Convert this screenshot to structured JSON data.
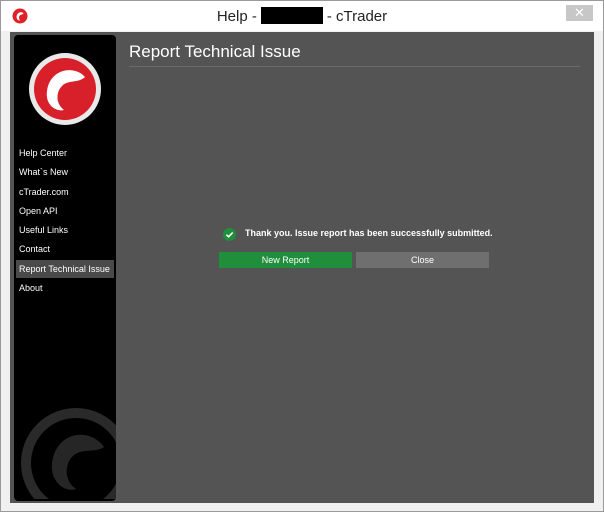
{
  "window": {
    "title_prefix": "Help -",
    "title_suffix": "- cTrader",
    "close_glyph": "✕"
  },
  "sidebar": {
    "items": [
      {
        "label": "Help Center"
      },
      {
        "label": "What`s New"
      },
      {
        "label": "cTrader.com"
      },
      {
        "label": "Open API"
      },
      {
        "label": "Useful Links"
      },
      {
        "label": "Contact"
      },
      {
        "label": "Report Technical Issue",
        "active": true
      },
      {
        "label": "About"
      }
    ]
  },
  "main": {
    "title": "Report Technical Issue",
    "status_message": "Thank you. Issue report has been successfully submitted.",
    "new_report_label": "New Report",
    "close_label": "Close"
  },
  "colors": {
    "brand_red": "#e0202a",
    "success_green": "#1f8f3b",
    "panel": "#545454"
  },
  "icons": {
    "app": "ctrader-logo-icon",
    "status": "check-circle-icon"
  }
}
